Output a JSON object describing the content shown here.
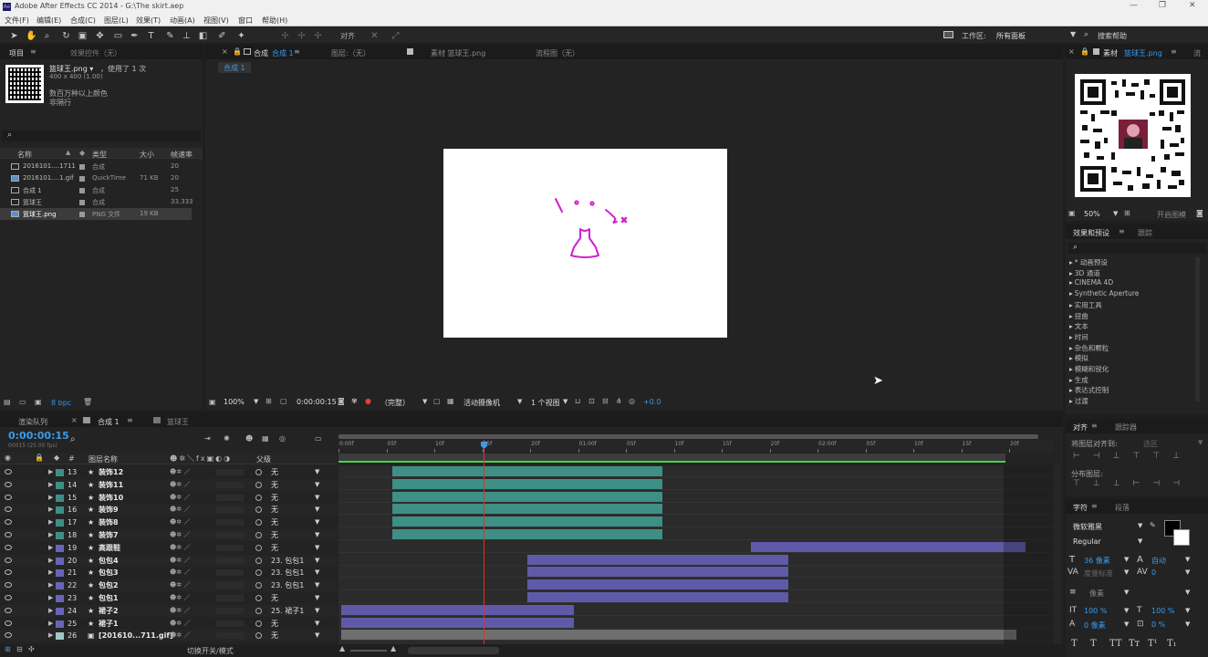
{
  "app": {
    "title": "Adobe After Effects CC 2014 - G:\\The skirt.aep",
    "window_controls": [
      "—",
      "❐",
      "✕"
    ]
  },
  "menu": [
    "文件(F)",
    "编辑(E)",
    "合成(C)",
    "图层(L)",
    "效果(T)",
    "动画(A)",
    "视图(V)",
    "窗口",
    "帮助(H)"
  ],
  "toolbar": {
    "align_label": "对齐",
    "workspace_label": "工作区:",
    "workspace_value": "所有面板",
    "search_help": "搜索帮助"
  },
  "project": {
    "tab_project": "项目",
    "tab_effects": "效果控件（无）",
    "item_name": "篮球王.png ▾",
    "used": "，使用了 1 次",
    "dims": "400 x 400 (1.00)",
    "colors": "数百万种以上颜色",
    "interlace": "非隔行",
    "col_name": "名称",
    "col_type": "类型",
    "col_size": "大小",
    "col_fps": "帧速率",
    "items": [
      {
        "name": "2016101....1711",
        "type": "合成",
        "size": "",
        "fps": "20",
        "icon": "comp"
      },
      {
        "name": "2016101....1.gif",
        "type": "QuickTime",
        "size": "71 KB",
        "fps": "20",
        "icon": "footage"
      },
      {
        "name": "合成 1",
        "type": "合成",
        "size": "",
        "fps": "25",
        "icon": "comp"
      },
      {
        "name": "篮球王",
        "type": "合成",
        "size": "",
        "fps": "33.333",
        "icon": "comp"
      },
      {
        "name": "篮球王.png",
        "type": "PNG 文件",
        "size": "19 KB",
        "fps": "",
        "icon": "footage"
      }
    ],
    "bpc": "8 bpc"
  },
  "composition": {
    "comp_tab": "合成",
    "comp_name": "合成 1",
    "layer_tab": "图层:（无）",
    "footage_tab": "素材 篮球王.png",
    "flow_tab": "流程图（无）",
    "sub_tab": "合成 1",
    "zoom": "100%",
    "timecode": "0:00:00:15",
    "quality": "（完整）",
    "camera": "活动摄像机",
    "views": "1 个视图",
    "exposure": "+0.0"
  },
  "footage_viewer": {
    "tab": "素材",
    "name": "篮球王.png",
    "zoom": "50%",
    "action": "开启图模"
  },
  "effects": {
    "tab": "效果和预设",
    "tab2": "跟踪",
    "items": [
      "* 动画预设",
      "3D 通道",
      "CINEMA 4D",
      "Synthetic Aperture",
      "实用工具",
      "扭曲",
      "文本",
      "时间",
      "杂色和颗粒",
      "模拟",
      "模糊和锐化",
      "生成",
      "表达式控制",
      "过渡"
    ]
  },
  "align": {
    "tab": "对齐",
    "tab2": "跟踪器",
    "label": "将图层对齐到:",
    "target": "选区",
    "distribute": "分布图层:"
  },
  "character": {
    "tab": "字符",
    "tab2": "段落",
    "font": "微软雅黑",
    "style": "Regular",
    "size": "36 像素",
    "leading": "自动",
    "kerning": "度量标准",
    "tracking": "0",
    "stroke": "像素",
    "vscale": "100 %",
    "hscale": "100 %",
    "baseline": "0 像素",
    "tsume": "0 %",
    "styles": [
      "T",
      "T",
      "TT",
      "Tт",
      "T¹",
      "T₁"
    ]
  },
  "timeline": {
    "tab_render": "渲染队列",
    "tab_comp": "合成 1",
    "tab_comp2": "篮球王",
    "timecode": "0:00:00:15",
    "fps_info": "00015 (25.00 fps)",
    "col_layer": "图层名称",
    "col_parent": "父级",
    "footer": "切换开关/模式",
    "ruler": [
      "0:00f",
      "05f",
      "10f",
      "15f",
      "20f",
      "01:00f",
      "05f",
      "10f",
      "15f",
      "20f",
      "02:00f",
      "05f",
      "10f",
      "15f",
      "20f"
    ],
    "layers": [
      {
        "num": "13",
        "name": "装饰12",
        "parent": "无",
        "color": "#3e8f85"
      },
      {
        "num": "14",
        "name": "装饰11",
        "parent": "无",
        "color": "#3e8f85"
      },
      {
        "num": "15",
        "name": "装饰10",
        "parent": "无",
        "color": "#3e8f85"
      },
      {
        "num": "16",
        "name": "装饰9",
        "parent": "无",
        "color": "#3e8f85"
      },
      {
        "num": "17",
        "name": "装饰8",
        "parent": "无",
        "color": "#3e8f85"
      },
      {
        "num": "18",
        "name": "装饰7",
        "parent": "无",
        "color": "#3e8f85"
      },
      {
        "num": "19",
        "name": "高跟鞋",
        "parent": "无",
        "color": "#6a64b8"
      },
      {
        "num": "20",
        "name": "包包4",
        "parent": "23. 包包1",
        "color": "#6a64b8"
      },
      {
        "num": "21",
        "name": "包包3",
        "parent": "23. 包包1",
        "color": "#6a64b8"
      },
      {
        "num": "22",
        "name": "包包2",
        "parent": "23. 包包1",
        "color": "#6a64b8"
      },
      {
        "num": "23",
        "name": "包包1",
        "parent": "无",
        "color": "#6a64b8"
      },
      {
        "num": "24",
        "name": "裙子2",
        "parent": "25. 裙子1",
        "color": "#6a64b8"
      },
      {
        "num": "25",
        "name": "裙子1",
        "parent": "无",
        "color": "#6a64b8"
      },
      {
        "num": "26",
        "name": "[201610...711.gif]",
        "parent": "无",
        "color": "#9cc8c4"
      }
    ]
  },
  "colors": {
    "accent": "#2d8ceb",
    "teal_bar": "#3e8f85",
    "purple_bar": "#5e5aa8",
    "gray_bar": "#6f6f6f",
    "playhead": "#e03030",
    "skirt": "#d020d0"
  }
}
